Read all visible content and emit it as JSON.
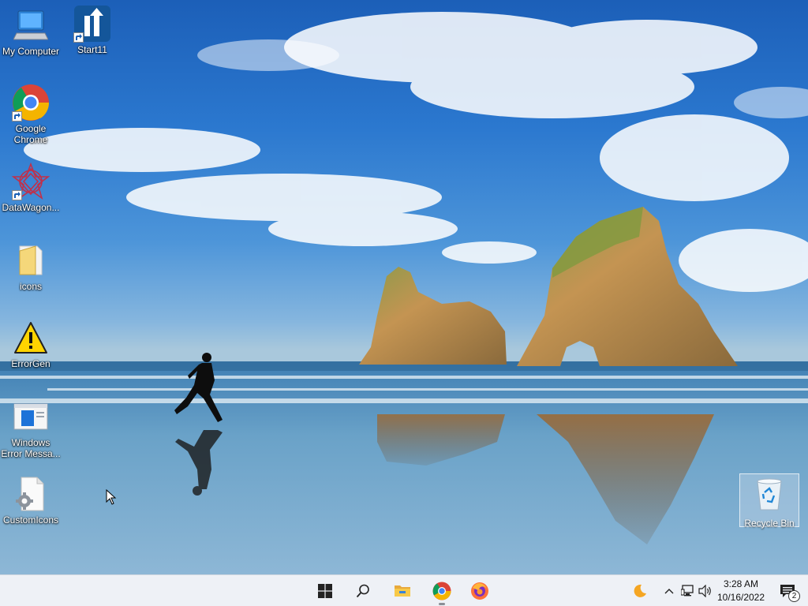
{
  "desktop": {
    "icons": [
      {
        "label": "My Computer",
        "icon": "computer-icon"
      },
      {
        "label": "Start11",
        "icon": "start11-icon"
      },
      {
        "label": "Google Chrome",
        "icon": "chrome-icon"
      },
      {
        "label": "DataWagon...",
        "icon": "datawagon-icon"
      },
      {
        "label": "icons",
        "icon": "folder-icon"
      },
      {
        "label": "ErrorGen",
        "icon": "warning-icon"
      },
      {
        "label": "Windows Error Messa...",
        "icon": "error-message-icon"
      },
      {
        "label": "CustomIcons",
        "icon": "custom-icons-file-icon"
      }
    ],
    "recycle_bin": {
      "label": "Recycle Bin",
      "icon": "recycle-bin-icon"
    }
  },
  "taskbar": {
    "pinned": [
      {
        "name": "start-button",
        "icon": "windows-logo-icon"
      },
      {
        "name": "search-button",
        "icon": "search-icon"
      },
      {
        "name": "file-explorer-button",
        "icon": "folder-icon"
      },
      {
        "name": "chrome-taskbar-button",
        "icon": "chrome-icon"
      },
      {
        "name": "firefox-taskbar-button",
        "icon": "firefox-icon"
      }
    ],
    "tray": {
      "icons": [
        "night-light-icon",
        "chevron-up-icon",
        "network-icon",
        "volume-icon"
      ],
      "clock": {
        "time": "3:28 AM",
        "date": "10/16/2022"
      },
      "notification_count": "2"
    }
  },
  "colors": {
    "sky_top": "#1c5fb8",
    "sea": "#4a86b8",
    "rock": "#b88a4c",
    "taskbar": "#eef1f6"
  }
}
